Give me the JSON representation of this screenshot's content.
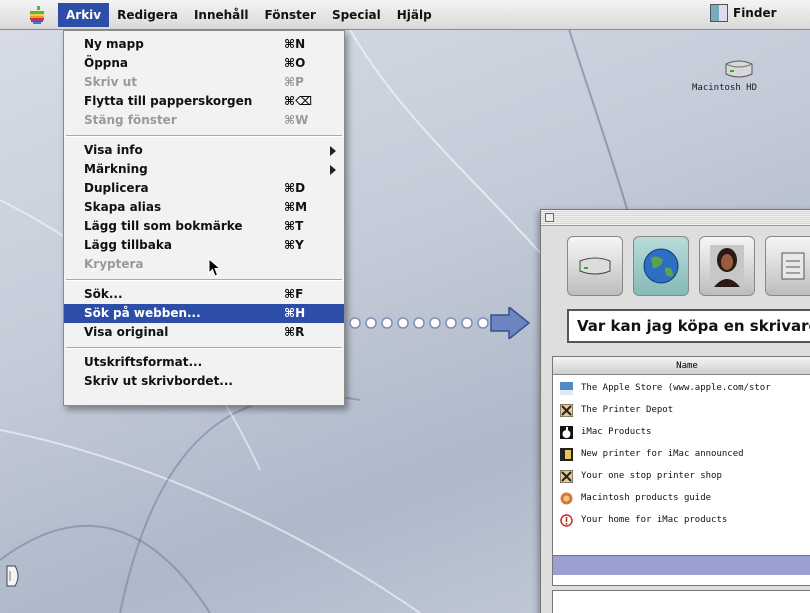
{
  "menubar": {
    "apple_icon": "apple-icon",
    "menus": [
      "Arkiv",
      "Redigera",
      "Innehåll",
      "Fönster",
      "Special",
      "Hjälp"
    ],
    "active_menu": "Arkiv",
    "app_name": "Finder",
    "highlight_color": "#2c4ea8"
  },
  "file_menu": {
    "items": [
      {
        "label": "Ny mapp",
        "shortcut": "⌘N",
        "enabled": true
      },
      {
        "label": "Öppna",
        "shortcut": "⌘O",
        "enabled": true
      },
      {
        "label": "Skriv ut",
        "shortcut": "⌘P",
        "enabled": false
      },
      {
        "label": "Flytta till papperskorgen",
        "shortcut": "⌘⌫",
        "enabled": true
      },
      {
        "label": "Stäng fönster",
        "shortcut": "⌘W",
        "enabled": false
      },
      {
        "label": "Visa info",
        "shortcut": "",
        "submenu": true,
        "enabled": true
      },
      {
        "label": "Märkning",
        "shortcut": "",
        "submenu": true,
        "enabled": true
      },
      {
        "label": "Duplicera",
        "shortcut": "⌘D",
        "enabled": true
      },
      {
        "label": "Skapa alias",
        "shortcut": "⌘M",
        "enabled": true
      },
      {
        "label": "Lägg till som bokmärke",
        "shortcut": "⌘T",
        "enabled": true
      },
      {
        "label": "Lägg tillbaka",
        "shortcut": "⌘Y",
        "enabled": true
      },
      {
        "label": "Kryptera",
        "shortcut": "",
        "enabled": false
      },
      {
        "label": "Sök...",
        "shortcut": "⌘F",
        "enabled": true
      },
      {
        "label": "Sök på webben...",
        "shortcut": "⌘H",
        "enabled": true,
        "highlighted": true
      },
      {
        "label": "Visa original",
        "shortcut": "⌘R",
        "enabled": true
      },
      {
        "label": "Utskriftsformat...",
        "shortcut": "",
        "enabled": true
      },
      {
        "label": "Skriv ut skrivbordet...",
        "shortcut": "",
        "enabled": true
      }
    ]
  },
  "desktop": {
    "disk_icon": "hard-disk-icon",
    "disk_label": "Macintosh HD"
  },
  "sherlock": {
    "channels": [
      "hard-disk-icon",
      "globe-icon",
      "person-icon",
      "shopping-icon"
    ],
    "active_channel": 1,
    "query": "Var kan jag köpa en skrivare",
    "column_name": "Name",
    "results": [
      {
        "icon": "apple-store-icon",
        "name": "The Apple Store (www.apple.com/stor"
      },
      {
        "icon": "printer-icon",
        "name": "The Printer Depot"
      },
      {
        "icon": "apple-icon",
        "name": "iMac Products"
      },
      {
        "icon": "news-icon",
        "name": "New printer for iMac announced"
      },
      {
        "icon": "printer-icon",
        "name": "Your one stop printer shop"
      },
      {
        "icon": "globe-icon",
        "name": "Macintosh products guide"
      },
      {
        "icon": "info-icon",
        "name": "Your home for iMac products"
      }
    ]
  }
}
